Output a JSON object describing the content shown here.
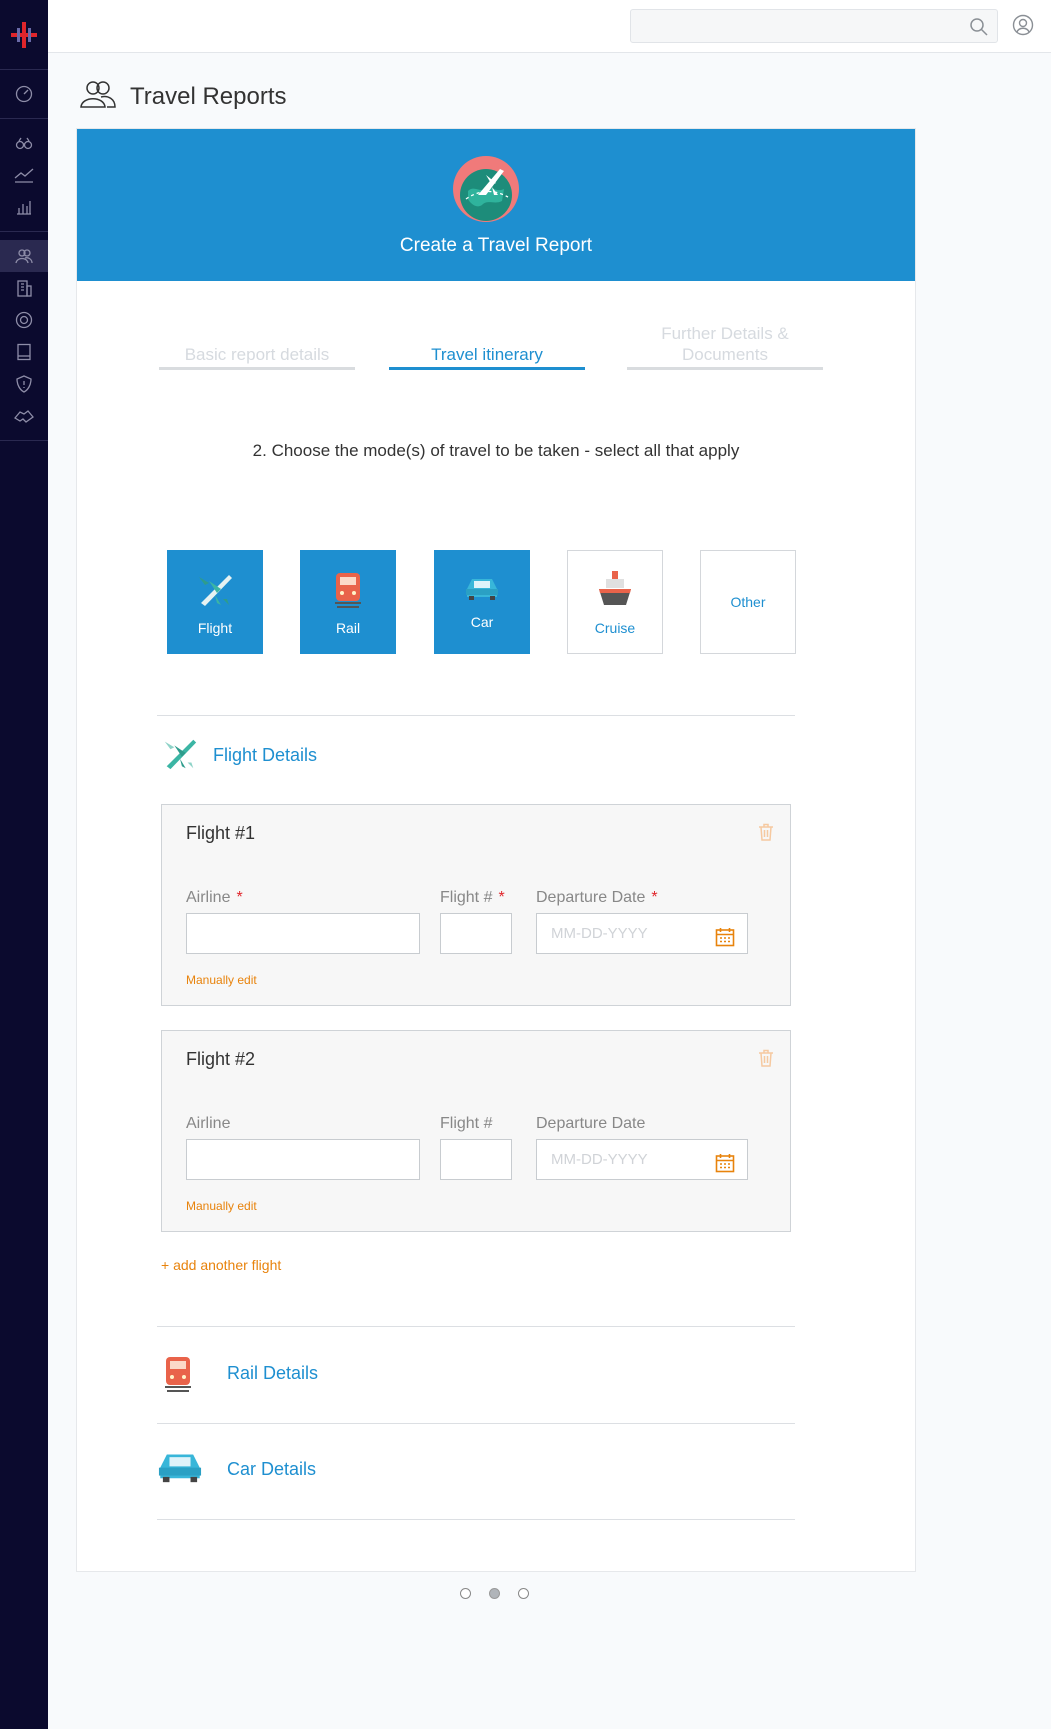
{
  "app": {
    "page_title": "Travel Reports",
    "card_title": "Create a Travel Report"
  },
  "sidebar": {
    "items": [
      "logo-icon",
      "dashboard-icon",
      "binoculars-icon",
      "trend-chart-icon",
      "bar-chart-icon",
      "travelers-icon",
      "building-icon",
      "globe-icon",
      "book-icon",
      "shield-icon",
      "handshake-icon"
    ],
    "active": "travelers-icon"
  },
  "search": {
    "placeholder": ""
  },
  "steps": [
    {
      "label": "Basic report details",
      "state": "inactive"
    },
    {
      "label": "Travel itinerary",
      "state": "active"
    },
    {
      "label": "Further Details & Documents",
      "state": "inactive"
    }
  ],
  "instruction": "2.  Choose the mode(s) of travel to be taken - select all that apply",
  "modes": [
    {
      "label": "Flight",
      "selected": true,
      "icon": "plane-icon"
    },
    {
      "label": "Rail",
      "selected": true,
      "icon": "train-icon"
    },
    {
      "label": "Car",
      "selected": true,
      "icon": "car-icon"
    },
    {
      "label": "Cruise",
      "selected": false,
      "icon": "ship-icon"
    },
    {
      "label": "Other",
      "selected": false,
      "icon": ""
    }
  ],
  "flight_section": {
    "title": "Flight Details",
    "flights": [
      {
        "title": "Flight #1",
        "airline_label": "Airline",
        "flight_no_label": "Flight #",
        "date_label": "Departure Date",
        "required": true,
        "airline_value": "",
        "flight_no_value": "",
        "date_placeholder": "MM-DD-YYYY",
        "manual_link": "Manually edit"
      },
      {
        "title": "Flight #2",
        "airline_label": "Airline",
        "flight_no_label": "Flight #",
        "date_label": "Departure Date",
        "required": false,
        "airline_value": "",
        "flight_no_value": "",
        "date_placeholder": "MM-DD-YYYY",
        "manual_link": "Manually edit"
      }
    ],
    "add_link": "+ add another flight"
  },
  "rail_section": {
    "title": "Rail Details"
  },
  "car_section": {
    "title": "Car Details"
  },
  "pagination": {
    "pages": 3,
    "current": 2
  },
  "colors": {
    "primary": "#1e8fd0",
    "sidebar": "#0b0a2e",
    "accent_orange": "#e8830c",
    "required": "#e0252b"
  }
}
